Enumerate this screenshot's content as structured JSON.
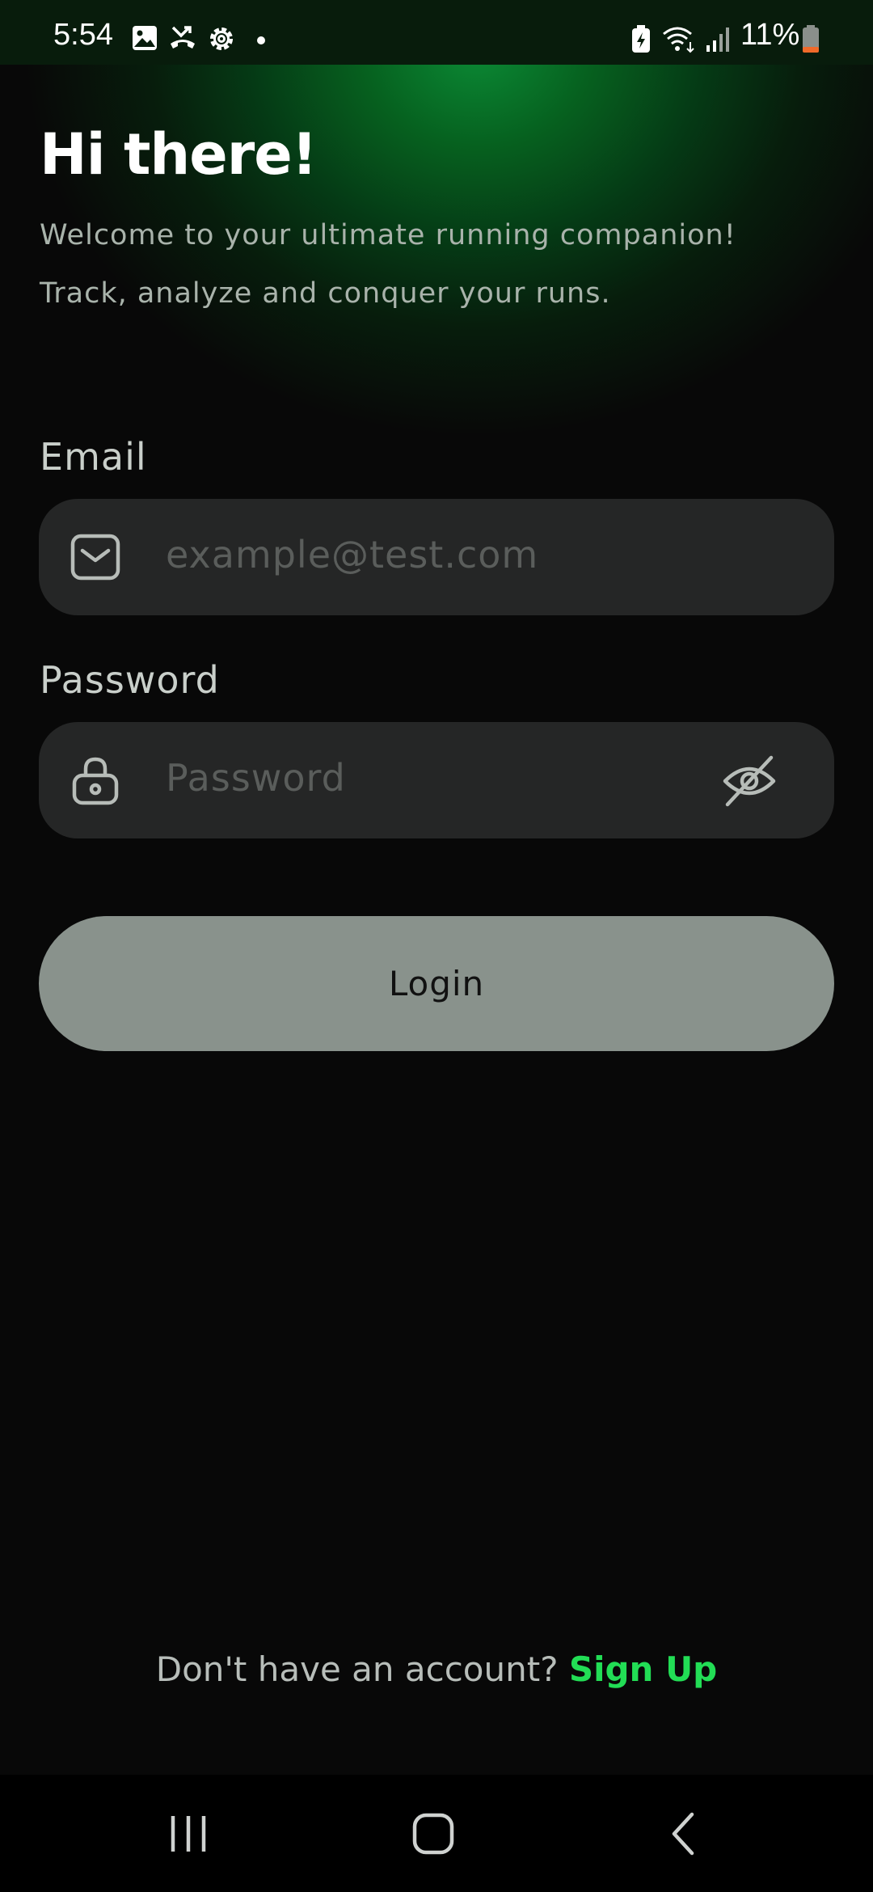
{
  "status_bar": {
    "time": "5:54",
    "battery_percent": "11%",
    "icons": [
      "image-icon",
      "missed-call-icon",
      "settings-icon",
      "dot-icon",
      "battery-saver-icon",
      "wifi-icon",
      "signal-icon",
      "battery-icon"
    ]
  },
  "header": {
    "title": "Hi there!",
    "subtitle_line1": "Welcome to your ultimate running companion!",
    "subtitle_line2": "Track, analyze and conquer your runs."
  },
  "form": {
    "email_label": "Email",
    "email_placeholder": "example@test.com",
    "email_value": "",
    "password_label": "Password",
    "password_placeholder": "Password",
    "password_value": "",
    "login_label": "Login"
  },
  "footer": {
    "prompt": "Don't have an account?",
    "signup_label": "Sign Up"
  },
  "nav": {
    "icons": [
      "recent-apps-icon",
      "home-icon",
      "back-icon"
    ]
  },
  "colors": {
    "accent": "#22dd55",
    "background": "#080808",
    "input_bg": "#252626",
    "button_bg": "#89928c"
  }
}
